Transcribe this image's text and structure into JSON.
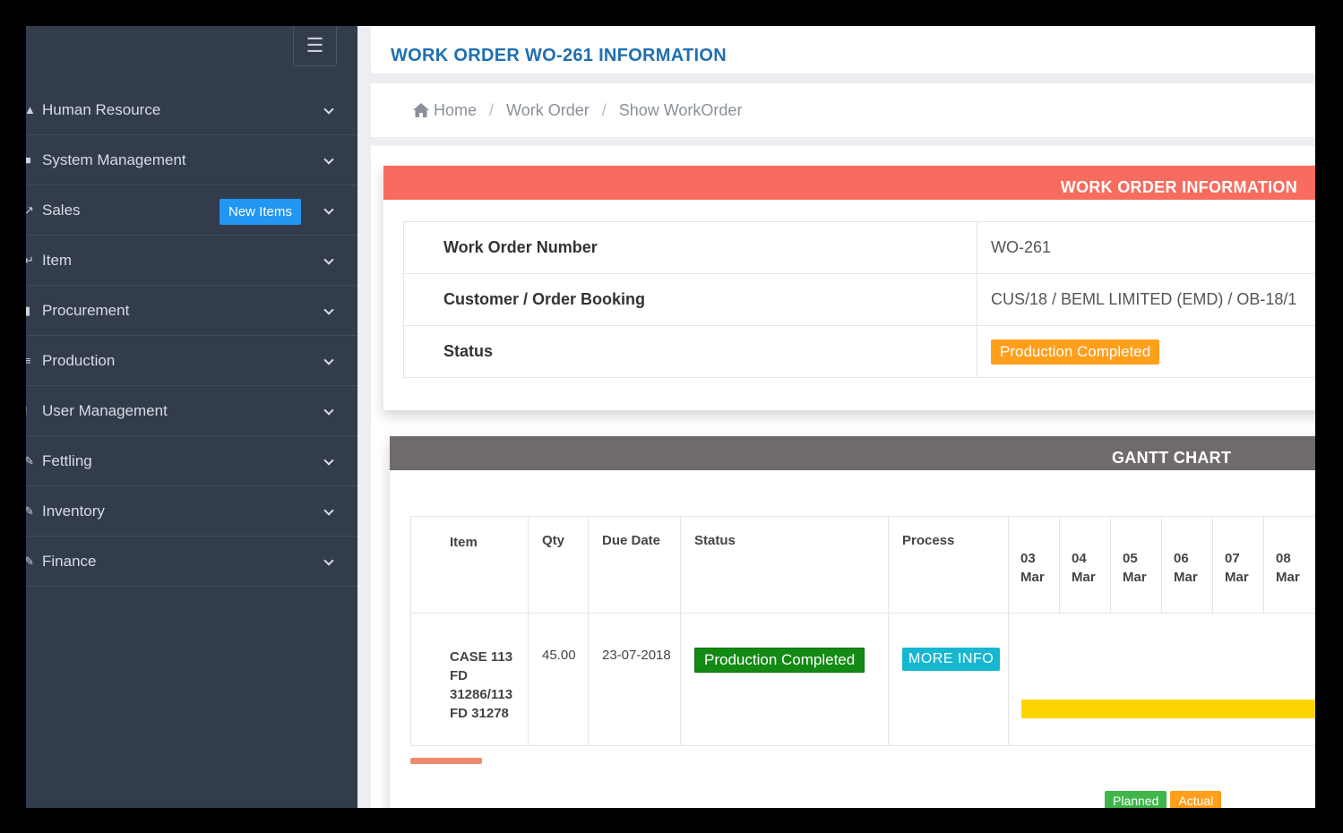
{
  "sidebar": {
    "items": [
      {
        "label": "Human Resource",
        "icon": "user-icon"
      },
      {
        "label": "System Management",
        "icon": "cog-icon"
      },
      {
        "label": "Sales",
        "icon": "sales-icon",
        "badge": "New Items"
      },
      {
        "label": "Item",
        "icon": "item-icon"
      },
      {
        "label": "Procurement",
        "icon": "procurement-icon"
      },
      {
        "label": "Production",
        "icon": "production-icon"
      },
      {
        "label": "User Management",
        "icon": "users-icon"
      },
      {
        "label": "Fettling",
        "icon": "fettling-icon"
      },
      {
        "label": "Inventory",
        "icon": "inventory-icon"
      },
      {
        "label": "Finance",
        "icon": "finance-icon"
      }
    ]
  },
  "page": {
    "title": "WORK ORDER WO-261 INFORMATION"
  },
  "breadcrumb": {
    "home": "Home",
    "work_order": "Work Order",
    "current": "Show WorkOrder",
    "separator": "/"
  },
  "work_order_info": {
    "header": "WORK ORDER INFORMATION",
    "rows": {
      "number_label": "Work Order Number",
      "number_value": "WO-261",
      "customer_label": "Customer / Order Booking",
      "customer_value": "CUS/18 / BEML LIMITED (EMD) / OB-18/1",
      "status_label": "Status",
      "status_value": "Production Completed"
    }
  },
  "gantt": {
    "header": "GANTT CHART",
    "columns": {
      "item": "Item",
      "qty": "Qty",
      "due_date": "Due Date",
      "status": "Status",
      "process": "Process"
    },
    "days": [
      {
        "d": "03",
        "m": "Mar"
      },
      {
        "d": "04",
        "m": "Mar"
      },
      {
        "d": "05",
        "m": "Mar"
      },
      {
        "d": "06",
        "m": "Mar"
      },
      {
        "d": "07",
        "m": "Mar"
      },
      {
        "d": "08",
        "m": "Mar"
      }
    ],
    "row": {
      "item_lines": [
        "CASE 113",
        "FD",
        "31286/113",
        "FD 31278"
      ],
      "qty": "45.00",
      "due_date": "23-07-2018",
      "status": "Production Completed",
      "process_button": "MORE INFO"
    },
    "legend": {
      "planned": "Planned",
      "actual": "Actual"
    }
  },
  "colors": {
    "sidebar_bg": "#323c4d",
    "title_blue": "#1f6fb2",
    "wo_header": "#f76c5e",
    "gantt_header": "#6f6b6a",
    "status_orange": "#ff9f1c",
    "status_green": "#138a13",
    "more_info": "#17b7d1",
    "gantt_bar": "#fdd400"
  }
}
